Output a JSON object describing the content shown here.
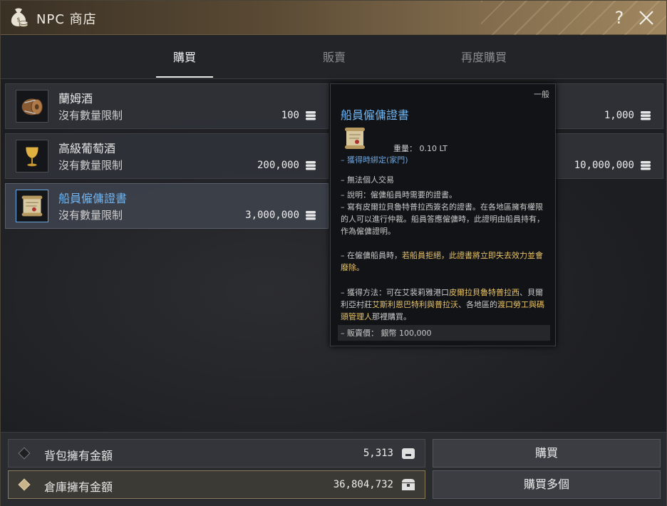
{
  "window": {
    "title": "NPC 商店"
  },
  "tabs": [
    {
      "label": "購買",
      "active": true
    },
    {
      "label": "販賣",
      "active": false
    },
    {
      "label": "再度購買",
      "active": false
    }
  ],
  "items": [
    {
      "name": "蘭姆酒",
      "limit": "沒有數量限制",
      "price": "100",
      "icon": "barrel-icon"
    },
    {
      "name": "高級葡萄酒",
      "limit": "沒有數量限制",
      "price": "200,000",
      "icon": "goblet-icon"
    },
    {
      "name": "船員僱傭證書",
      "limit": "沒有數量限制",
      "price": "3,000,000",
      "icon": "scroll-icon",
      "selected": true
    },
    {
      "name": "",
      "limit": "",
      "price": "1,000",
      "icon": ""
    },
    {
      "name": "",
      "limit": "",
      "price": "10,000,000",
      "icon": ""
    }
  ],
  "tooltip": {
    "grade": "一般",
    "name": "船員僱傭證書",
    "weight": "重量： 0.10 LT",
    "bind": "– 獲得時綁定(家門)",
    "trade": "– 無法個人交易",
    "desc_title": "– 說明：僱傭船員時需要的證書。",
    "desc_body": "– 寫有皮爾拉貝魯特普拉西簽名的證書。在各地區擁有權限的人可以進行仲裁。船員答應僱傭時，此證明由船員持有，作為僱傭證明。",
    "warn_prefix": "– 在僱傭船員時，",
    "warn_gold": "若船員拒絕，此證書將立即失去效力並會廢除。",
    "obtain_prefix": "– 獲得方法：可在艾裴莉雅港口",
    "obtain_gold1": "皮爾拉貝魯特普拉西",
    "obtain_mid": "、貝爾利亞村莊",
    "obtain_gold2": "艾斯利恩巴特利與普拉沃",
    "obtain_mid2": "、各地區的",
    "obtain_gold3": "渡口勞工與碼頭管理人",
    "obtain_end": "那裡購買。",
    "sell_price": "– 販賣價： 銀幣 100,000"
  },
  "money": {
    "inventory_label": "背包擁有金額",
    "inventory_value": "5,313",
    "warehouse_label": "倉庫擁有金額",
    "warehouse_value": "36,804,732"
  },
  "buttons": {
    "buy": "購買",
    "buy_multiple": "購買多個"
  },
  "colors": {
    "accent_blue": "#6fb4f0",
    "gold_text": "#e8c46a",
    "title_bar": "#8a7352"
  }
}
